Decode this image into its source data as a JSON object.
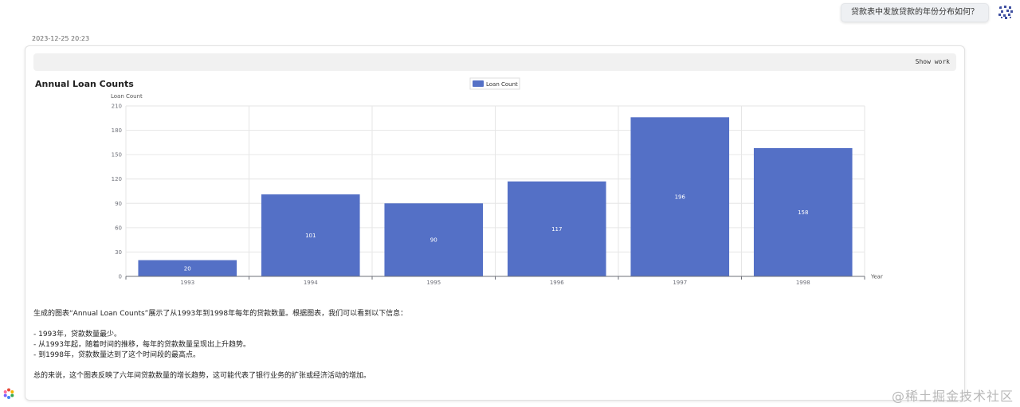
{
  "user": {
    "question": "贷款表中发放贷款的年份分布如何？"
  },
  "message": {
    "timestamp": "2023-12-25 20:23",
    "show_work_label": "Show work"
  },
  "chart_data": {
    "type": "bar",
    "title": "Annual Loan Counts",
    "legend": [
      "Loan Count"
    ],
    "legend_position": "top-center",
    "xlabel": "Year",
    "ylabel": "Loan Count",
    "categories": [
      "1993",
      "1994",
      "1995",
      "1996",
      "1997",
      "1998"
    ],
    "series": [
      {
        "name": "Loan Count",
        "values": [
          20,
          101,
          90,
          117,
          196,
          158
        ]
      }
    ],
    "ylim": [
      0,
      210
    ],
    "yticks": [
      0,
      30,
      60,
      90,
      120,
      150,
      180,
      210
    ],
    "grid": true,
    "colors": {
      "bar": "#5470c6",
      "grid": "#e6e6e6",
      "axis": "#6e7079"
    }
  },
  "summary": {
    "intro": "生成的图表“Annual Loan Counts”展示了从1993年到1998年每年的贷款数量。根据图表，我们可以看到以下信息：",
    "points": [
      "- 1993年，贷款数量最少。",
      "- 从1993年起，随着时间的推移，每年的贷款数量呈现出上升趋势。",
      "- 到1998年，贷款数量达到了这个时间段的最高点。"
    ],
    "conclusion": "总的来说，这个图表反映了六年间贷款数量的增长趋势，这可能代表了银行业务的扩张或经济活动的增加。"
  },
  "watermark": "@稀土掘金技术社区",
  "icons": {
    "avatar": "avatar-icon",
    "loader": "loader-icon"
  }
}
